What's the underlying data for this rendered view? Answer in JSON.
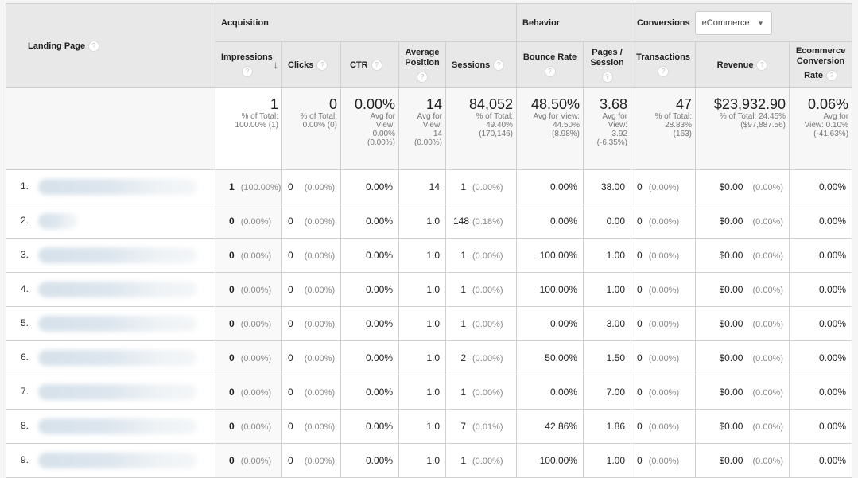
{
  "header": {
    "landing_page": "Landing Page",
    "groups": {
      "acquisition": "Acquisition",
      "behavior": "Behavior",
      "conversions": "Conversions"
    },
    "conversions_dropdown": {
      "selected": "eCommerce"
    },
    "columns": {
      "impressions": "Impressions",
      "clicks": "Clicks",
      "ctr": "CTR",
      "avg_position": "Average Position",
      "sessions": "Sessions",
      "bounce_rate": "Bounce Rate",
      "pages_session": "Pages / Session",
      "transactions": "Transactions",
      "revenue": "Revenue",
      "ecom_rate_line1": "Ecommerce Conversion",
      "ecom_rate_line2": "Rate"
    },
    "help_glyph": "?",
    "sort_glyph": "↓"
  },
  "totals": {
    "impressions": {
      "value": "1",
      "l1": "% of Total:",
      "l2": "100.00% (1)"
    },
    "clicks": {
      "value": "0",
      "l1": "% of Total:",
      "l2": "0.00% (0)"
    },
    "ctr": {
      "value": "0.00%",
      "l1": "Avg for",
      "l2": "View:",
      "l3": "0.00%",
      "l4": "(0.00%)"
    },
    "avg_position": {
      "value": "14",
      "l1": "Avg for",
      "l2": "View:",
      "l3": "14",
      "l4": "(0.00%)"
    },
    "sessions": {
      "value": "84,052",
      "l1": "% of Total:",
      "l2": "49.40%",
      "l3": "(170,146)"
    },
    "bounce_rate": {
      "value": "48.50%",
      "l1": "Avg for View:",
      "l2": "44.50%",
      "l3": "(8.98%)"
    },
    "pages_session": {
      "value": "3.68",
      "l1": "Avg for",
      "l2": "View:",
      "l3": "3.92",
      "l4": "(-6.35%)"
    },
    "transactions": {
      "value": "47",
      "l1": "% of Total:",
      "l2": "28.83%",
      "l3": "(163)"
    },
    "revenue": {
      "value": "$23,932.90",
      "l1": "% of Total: 24.45%",
      "l2": "($97,887.56)"
    },
    "ecom_rate": {
      "value": "0.06%",
      "l1": "Avg for",
      "l2": "View: 0.10%",
      "l3": "(-41.63%)"
    }
  },
  "rows": [
    {
      "rank": "1.",
      "impressions": "1",
      "impressions_pct": "(100.00%)",
      "clicks": "0",
      "clicks_pct": "(0.00%)",
      "ctr": "0.00%",
      "avg_position": "14",
      "sessions": "1",
      "sessions_pct": "(0.00%)",
      "bounce_rate": "0.00%",
      "pages_session": "38.00",
      "transactions": "0",
      "transactions_pct": "(0.00%)",
      "revenue": "$0.00",
      "revenue_pct": "(0.00%)",
      "ecom_rate": "0.00%"
    },
    {
      "rank": "2.",
      "impressions": "0",
      "impressions_pct": "(0.00%)",
      "clicks": "0",
      "clicks_pct": "(0.00%)",
      "ctr": "0.00%",
      "avg_position": "1.0",
      "sessions": "148",
      "sessions_pct": "(0.18%)",
      "bounce_rate": "0.00%",
      "pages_session": "0.00",
      "transactions": "0",
      "transactions_pct": "(0.00%)",
      "revenue": "$0.00",
      "revenue_pct": "(0.00%)",
      "ecom_rate": "0.00%"
    },
    {
      "rank": "3.",
      "impressions": "0",
      "impressions_pct": "(0.00%)",
      "clicks": "0",
      "clicks_pct": "(0.00%)",
      "ctr": "0.00%",
      "avg_position": "1.0",
      "sessions": "1",
      "sessions_pct": "(0.00%)",
      "bounce_rate": "100.00%",
      "pages_session": "1.00",
      "transactions": "0",
      "transactions_pct": "(0.00%)",
      "revenue": "$0.00",
      "revenue_pct": "(0.00%)",
      "ecom_rate": "0.00%"
    },
    {
      "rank": "4.",
      "impressions": "0",
      "impressions_pct": "(0.00%)",
      "clicks": "0",
      "clicks_pct": "(0.00%)",
      "ctr": "0.00%",
      "avg_position": "1.0",
      "sessions": "1",
      "sessions_pct": "(0.00%)",
      "bounce_rate": "100.00%",
      "pages_session": "1.00",
      "transactions": "0",
      "transactions_pct": "(0.00%)",
      "revenue": "$0.00",
      "revenue_pct": "(0.00%)",
      "ecom_rate": "0.00%"
    },
    {
      "rank": "5.",
      "impressions": "0",
      "impressions_pct": "(0.00%)",
      "clicks": "0",
      "clicks_pct": "(0.00%)",
      "ctr": "0.00%",
      "avg_position": "1.0",
      "sessions": "1",
      "sessions_pct": "(0.00%)",
      "bounce_rate": "0.00%",
      "pages_session": "3.00",
      "transactions": "0",
      "transactions_pct": "(0.00%)",
      "revenue": "$0.00",
      "revenue_pct": "(0.00%)",
      "ecom_rate": "0.00%"
    },
    {
      "rank": "6.",
      "impressions": "0",
      "impressions_pct": "(0.00%)",
      "clicks": "0",
      "clicks_pct": "(0.00%)",
      "ctr": "0.00%",
      "avg_position": "1.0",
      "sessions": "2",
      "sessions_pct": "(0.00%)",
      "bounce_rate": "50.00%",
      "pages_session": "1.50",
      "transactions": "0",
      "transactions_pct": "(0.00%)",
      "revenue": "$0.00",
      "revenue_pct": "(0.00%)",
      "ecom_rate": "0.00%"
    },
    {
      "rank": "7.",
      "impressions": "0",
      "impressions_pct": "(0.00%)",
      "clicks": "0",
      "clicks_pct": "(0.00%)",
      "ctr": "0.00%",
      "avg_position": "1.0",
      "sessions": "1",
      "sessions_pct": "(0.00%)",
      "bounce_rate": "0.00%",
      "pages_session": "7.00",
      "transactions": "0",
      "transactions_pct": "(0.00%)",
      "revenue": "$0.00",
      "revenue_pct": "(0.00%)",
      "ecom_rate": "0.00%"
    },
    {
      "rank": "8.",
      "impressions": "0",
      "impressions_pct": "(0.00%)",
      "clicks": "0",
      "clicks_pct": "(0.00%)",
      "ctr": "0.00%",
      "avg_position": "1.0",
      "sessions": "7",
      "sessions_pct": "(0.01%)",
      "bounce_rate": "42.86%",
      "pages_session": "1.86",
      "transactions": "0",
      "transactions_pct": "(0.00%)",
      "revenue": "$0.00",
      "revenue_pct": "(0.00%)",
      "ecom_rate": "0.00%"
    },
    {
      "rank": "9.",
      "impressions": "0",
      "impressions_pct": "(0.00%)",
      "clicks": "0",
      "clicks_pct": "(0.00%)",
      "ctr": "0.00%",
      "avg_position": "1.0",
      "sessions": "1",
      "sessions_pct": "(0.00%)",
      "bounce_rate": "100.00%",
      "pages_session": "1.00",
      "transactions": "0",
      "transactions_pct": "(0.00%)",
      "revenue": "$0.00",
      "revenue_pct": "(0.00%)",
      "ecom_rate": "0.00%"
    }
  ]
}
